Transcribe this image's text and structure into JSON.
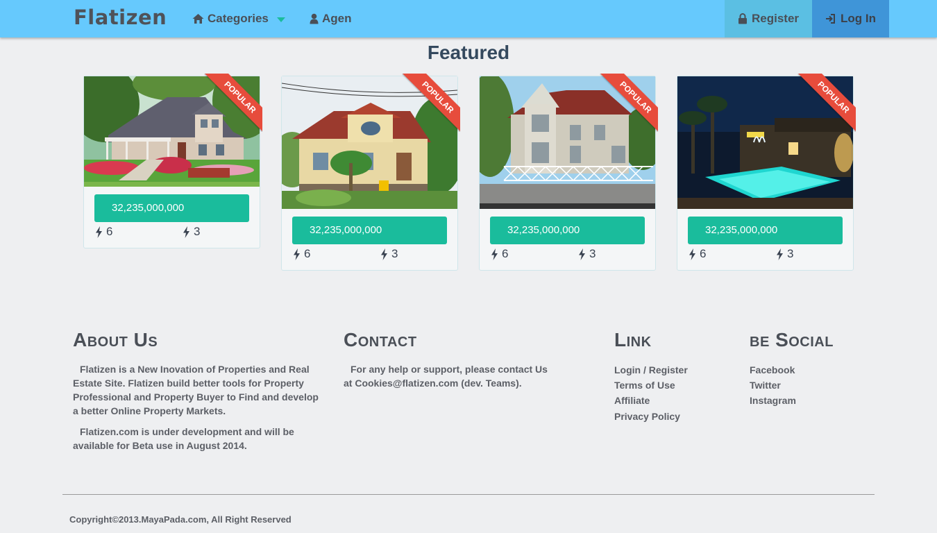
{
  "nav": {
    "logo": "Flatizen",
    "categories_label": "Categories",
    "agen_label": "Agen",
    "register_label": "Register",
    "login_label": "Log In"
  },
  "featured": {
    "title": "Featured",
    "cards": [
      {
        "ribbon": "POPULAR",
        "price": "32,235,000,000",
        "stat1": "6",
        "stat2": "3"
      },
      {
        "ribbon": "POPULAR",
        "price": "32,235,000,000",
        "stat1": "6",
        "stat2": "3"
      },
      {
        "ribbon": "POPULAR",
        "price": "32,235,000,000",
        "stat1": "6",
        "stat2": "3"
      },
      {
        "ribbon": "POPULAR",
        "price": "32,235,000,000",
        "stat1": "6",
        "stat2": "3"
      }
    ]
  },
  "footer": {
    "about": {
      "title": "About Us",
      "p1": "Flatizen is a New Inovation of Properties and Real Estate Site. Flatizen build better tools for Property Professional and Property Buyer to Find and develop a better Online Property Markets.",
      "p2": "Flatizen.com is under development and will be available for Beta use in August 2014."
    },
    "contact": {
      "title": "Contact",
      "p1": "For any help or support, please contact Us at Cookies@flatizen.com (dev. Teams)."
    },
    "link": {
      "title": "Link",
      "items": [
        "Login / Register",
        "Terms of Use",
        "Affiliate",
        "Privacy Policy"
      ]
    },
    "social": {
      "title": "be Social",
      "items": [
        "Facebook",
        "Twitter",
        "Instagram"
      ]
    },
    "copyright": "Copyright©2013.MayaPada.com, All Right Reserved"
  },
  "colors": {
    "navbar": "#66c9fd",
    "accent": "#1abc9c",
    "ribbon": "#e74c3c",
    "login": "#3f95d8"
  }
}
